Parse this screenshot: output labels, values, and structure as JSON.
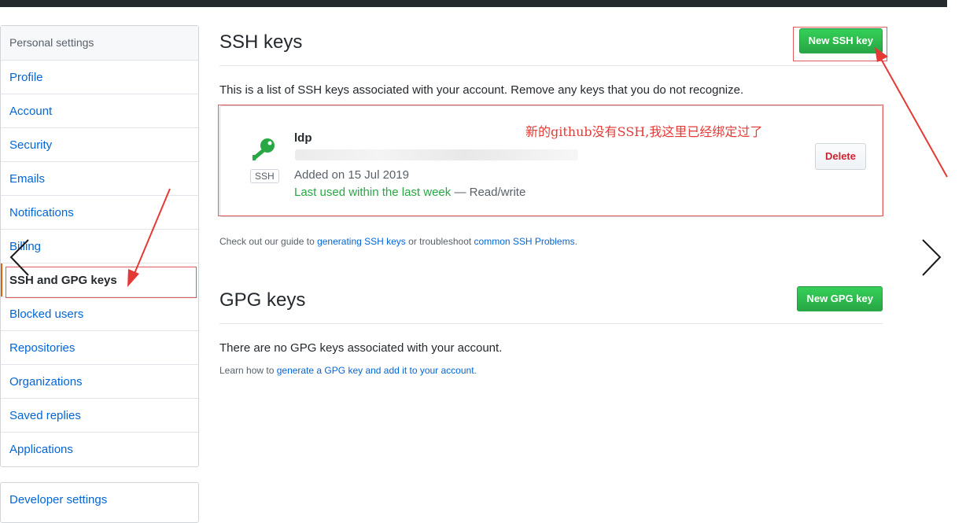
{
  "sidebar": {
    "header": "Personal settings",
    "items": [
      {
        "label": "Profile"
      },
      {
        "label": "Account"
      },
      {
        "label": "Security"
      },
      {
        "label": "Emails"
      },
      {
        "label": "Notifications"
      },
      {
        "label": "Billing"
      },
      {
        "label": "SSH and GPG keys",
        "selected": true
      },
      {
        "label": "Blocked users"
      },
      {
        "label": "Repositories"
      },
      {
        "label": "Organizations"
      },
      {
        "label": "Saved replies"
      },
      {
        "label": "Applications"
      }
    ],
    "developer_settings": "Developer settings"
  },
  "ssh": {
    "title": "SSH keys",
    "new_button": "New SSH key",
    "description": "This is a list of SSH keys associated with your account. Remove any keys that you do not recognize.",
    "key": {
      "title": "ldp",
      "badge": "SSH",
      "added": "Added on 15 Jul 2019",
      "last_used": "Last used within the last week",
      "access": " — Read/write",
      "delete_label": "Delete"
    },
    "annotation": "新的github没有SSH,我这里已经绑定过了",
    "guide_prefix": "Check out our guide to ",
    "guide_link1": "generating SSH keys",
    "guide_mid": " or troubleshoot ",
    "guide_link2": "common SSH Problems",
    "guide_suffix": "."
  },
  "gpg": {
    "title": "GPG keys",
    "new_button": "New GPG key",
    "none_text": "There are no GPG keys associated with your account.",
    "learn_prefix": "Learn how to ",
    "learn_link": "generate a GPG key and add it to your account",
    "learn_suffix": "."
  },
  "colors": {
    "accent_green": "#28a745",
    "link_blue": "#0366d6",
    "annotation_red": "#e53935"
  },
  "icons": {
    "key": "key-icon",
    "prev": "chevron-left-icon",
    "next": "chevron-right-icon"
  }
}
